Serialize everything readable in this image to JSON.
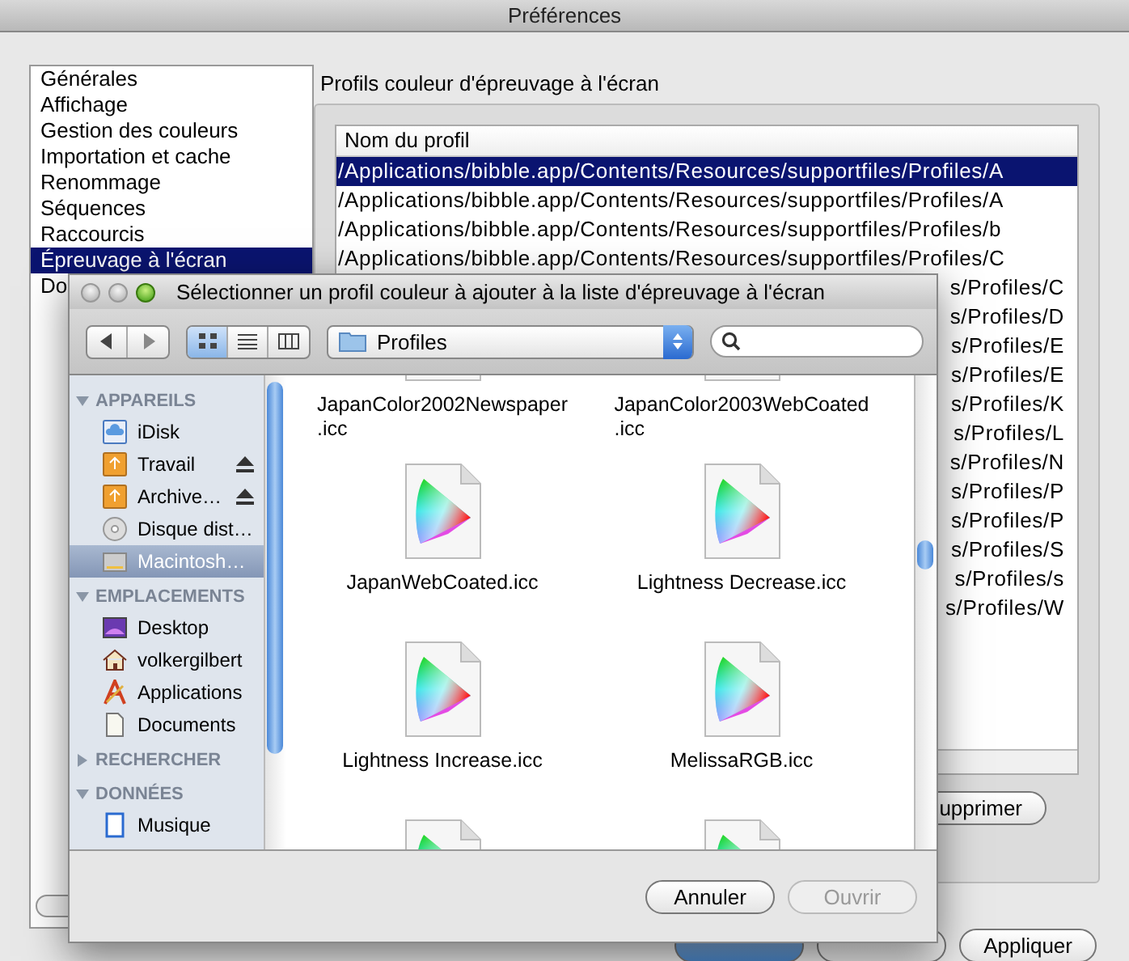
{
  "window": {
    "title": "Préférences"
  },
  "categories": [
    {
      "label": "Générales",
      "selected": false
    },
    {
      "label": "Affichage",
      "selected": false
    },
    {
      "label": "Gestion des couleurs",
      "selected": false
    },
    {
      "label": "Importation et cache",
      "selected": false
    },
    {
      "label": "Renommage",
      "selected": false
    },
    {
      "label": "Séquences",
      "selected": false
    },
    {
      "label": "Raccourcis",
      "selected": false
    },
    {
      "label": "Épreuvage à l'écran",
      "selected": true
    },
    {
      "label": "Do",
      "selected": false
    }
  ],
  "group": {
    "title": "Profils couleur d'épreuvage à l'écran",
    "table": {
      "columns": [
        "Nom du profil"
      ],
      "rows": [
        {
          "text": "/Applications/bibble.app/Contents/Resources/supportfiles/Profiles/A",
          "selected": true,
          "covered": false
        },
        {
          "text": "/Applications/bibble.app/Contents/Resources/supportfiles/Profiles/A",
          "selected": false,
          "covered": false
        },
        {
          "text": "/Applications/bibble.app/Contents/Resources/supportfiles/Profiles/b",
          "selected": false,
          "covered": false
        },
        {
          "text": "/Applications/bibble.app/Contents/Resources/supportfiles/Profiles/C",
          "selected": false,
          "covered": false
        },
        {
          "text": "s/Profiles/C",
          "selected": false,
          "covered": true
        },
        {
          "text": "s/Profiles/D",
          "selected": false,
          "covered": true
        },
        {
          "text": "s/Profiles/E",
          "selected": false,
          "covered": true
        },
        {
          "text": "s/Profiles/E",
          "selected": false,
          "covered": true
        },
        {
          "text": "s/Profiles/K",
          "selected": false,
          "covered": true
        },
        {
          "text": "s/Profiles/L",
          "selected": false,
          "covered": true
        },
        {
          "text": "s/Profiles/N",
          "selected": false,
          "covered": true
        },
        {
          "text": "s/Profiles/P",
          "selected": false,
          "covered": true
        },
        {
          "text": "s/Profiles/P",
          "selected": false,
          "covered": true
        },
        {
          "text": "s/Profiles/S",
          "selected": false,
          "covered": true
        },
        {
          "text": "s/Profiles/s",
          "selected": false,
          "covered": true
        },
        {
          "text": "s/Profiles/W",
          "selected": false,
          "covered": true
        }
      ]
    },
    "remove_button": "upprimer"
  },
  "buttons": [
    {
      "default": true
    },
    {
      "default": false
    },
    {
      "label": "Appliquer",
      "default": false
    }
  ],
  "dialog": {
    "title": "Sélectionner un profil couleur à ajouter à la liste d'épreuvage à l'écran",
    "views": [
      {
        "kind": "icons",
        "selected": true
      },
      {
        "kind": "list",
        "selected": false
      },
      {
        "kind": "columns",
        "selected": false
      }
    ],
    "path": "Profiles",
    "sidebar": [
      {
        "heading": "APPAREILS",
        "expanded": true,
        "items": [
          {
            "label": "iDisk",
            "kind": "idisk",
            "ejectable": false,
            "selected": false
          },
          {
            "label": "Travail",
            "kind": "external",
            "ejectable": true,
            "selected": false
          },
          {
            "label": "Archive…",
            "kind": "external",
            "ejectable": true,
            "selected": false
          },
          {
            "label": "Disque dist…",
            "kind": "disc",
            "ejectable": false,
            "selected": false
          },
          {
            "label": "Macintosh…",
            "kind": "harddisk",
            "ejectable": false,
            "selected": true
          }
        ]
      },
      {
        "heading": "EMPLACEMENTS",
        "expanded": true,
        "items": [
          {
            "label": "Desktop",
            "kind": "desktop",
            "ejectable": false,
            "selected": false
          },
          {
            "label": "volkergilbert",
            "kind": "home",
            "ejectable": false,
            "selected": false
          },
          {
            "label": "Applications",
            "kind": "applications",
            "ejectable": false,
            "selected": false
          },
          {
            "label": "Documents",
            "kind": "documents",
            "ejectable": false,
            "selected": false
          }
        ]
      },
      {
        "heading": "RECHERCHER",
        "expanded": false
      },
      {
        "heading": "DONNÉES",
        "expanded": true,
        "items": [
          {
            "label": "Musique",
            "kind": "music",
            "ejectable": false,
            "selected": false
          }
        ]
      }
    ],
    "files": [
      {
        "kind": "labelled",
        "lines": [
          "JapanColor2002Newspaper",
          ".icc"
        ]
      },
      {
        "kind": "labelled",
        "lines": [
          "JapanColor2003WebCoated",
          ".icc"
        ]
      },
      {
        "kind": "labelled",
        "lines": [
          "JapanWebCoated.icc"
        ]
      },
      {
        "kind": "labelled",
        "lines": [
          "Lightness Decrease.icc"
        ]
      },
      {
        "kind": "labelled",
        "lines": [
          "Lightness Increase.icc"
        ]
      },
      {
        "kind": "labelled",
        "lines": [
          "MelissaRGB.icc"
        ]
      },
      {
        "kind": "icon-only"
      },
      {
        "kind": "icon-only"
      }
    ],
    "buttons": [
      {
        "label": "Annuler",
        "disabled": false
      },
      {
        "label": "Ouvrir",
        "disabled": true
      }
    ]
  }
}
